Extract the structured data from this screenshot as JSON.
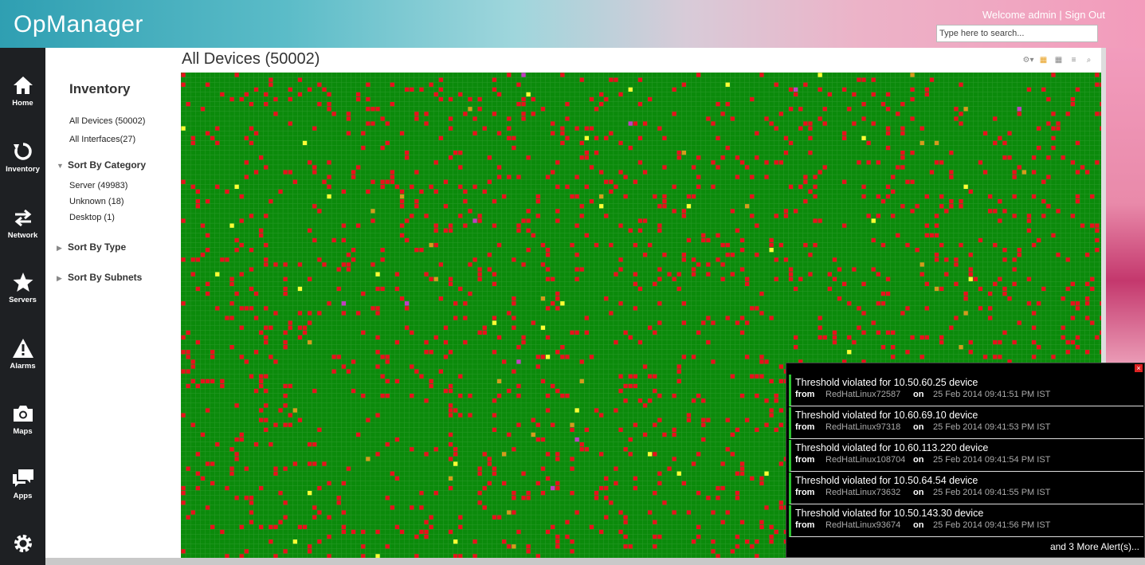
{
  "header": {
    "logo": "OpManager",
    "welcome": "Welcome admin",
    "separator": " | ",
    "sign_out": "Sign Out",
    "search_placeholder": "Type here to search..."
  },
  "nav": [
    {
      "label": "Home",
      "icon": "home-icon"
    },
    {
      "label": "Inventory",
      "icon": "refresh-icon"
    },
    {
      "label": "Network",
      "icon": "arrows-icon"
    },
    {
      "label": "Servers",
      "icon": "star-icon"
    },
    {
      "label": "Alarms",
      "icon": "warning-icon"
    },
    {
      "label": "Maps",
      "icon": "camera-icon"
    },
    {
      "label": "Apps",
      "icon": "chat-icon"
    },
    {
      "label": "",
      "icon": "gear-icon"
    }
  ],
  "inventory": {
    "title": "Inventory",
    "all_devices": "All Devices (50002)",
    "all_interfaces": "All Interfaces(27)",
    "sort_category": "Sort By Category",
    "categories": [
      "Server (49983)",
      "Unknown (18)",
      "Desktop (1)"
    ],
    "sort_type": "Sort By Type",
    "sort_subnets": "Sort By Subnets"
  },
  "content": {
    "title": "All Devices (50002)"
  },
  "status_colors": {
    "clear": "#0b8a0b",
    "critical": "#e8101a",
    "attention": "#ffff33",
    "trouble": "#d69a1c",
    "unmanaged": "#c23cc2"
  },
  "alerts": {
    "items": [
      {
        "title": "Threshold violated for 10.50.60.25 device",
        "from_label": "from",
        "source": "RedHatLinux72587",
        "on_label": "on",
        "time": "25 Feb 2014 09:41:51 PM IST"
      },
      {
        "title": "Threshold violated for 10.60.69.10 device",
        "from_label": "from",
        "source": "RedHatLinux97318",
        "on_label": "on",
        "time": "25 Feb 2014 09:41:53 PM IST"
      },
      {
        "title": "Threshold violated for 10.60.113.220 device",
        "from_label": "from",
        "source": "RedHatLinux108704",
        "on_label": "on",
        "time": "25 Feb 2014 09:41:54 PM IST"
      },
      {
        "title": "Threshold violated for 10.50.64.54 device",
        "from_label": "from",
        "source": "RedHatLinux73632",
        "on_label": "on",
        "time": "25 Feb 2014 09:41:55 PM IST"
      },
      {
        "title": "Threshold violated for 10.50.143.30 device",
        "from_label": "from",
        "source": "RedHatLinux93674",
        "on_label": "on",
        "time": "25 Feb 2014 09:41:56 PM IST"
      }
    ],
    "more": "and 3 More Alert(s)..."
  }
}
